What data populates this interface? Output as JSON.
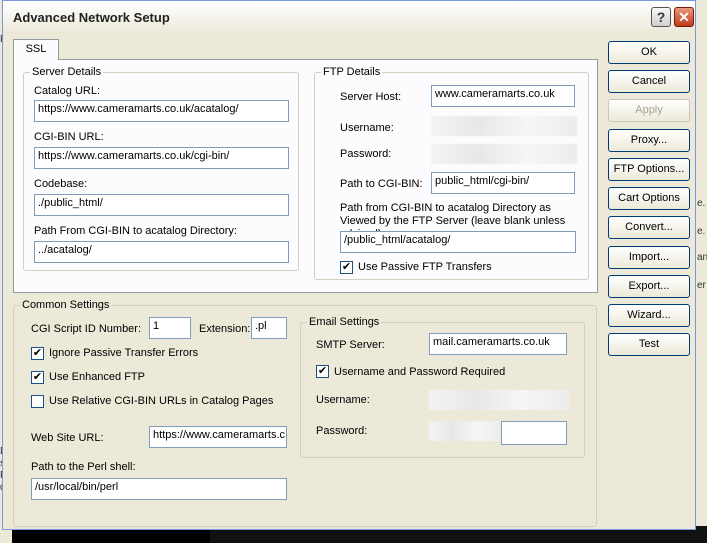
{
  "window": {
    "title": "Advanced Network Setup"
  },
  "tabs": [
    {
      "label": "SSL"
    }
  ],
  "server_details": {
    "legend": "Server Details",
    "catalog_url": {
      "label": "Catalog URL:",
      "value": "https://www.cameramarts.co.uk/acatalog/"
    },
    "cgi_bin_url": {
      "label": "CGI-BIN URL:",
      "value": "https://www.cameramarts.co.uk/cgi-bin/"
    },
    "codebase": {
      "label": "Codebase:",
      "value": "./public_html/"
    },
    "path_cgi_to_catalog": {
      "label": "Path From CGI-BIN to acatalog Directory:",
      "value": "../acatalog/"
    }
  },
  "ftp_details": {
    "legend": "FTP Details",
    "server_host": {
      "label": "Server Host:",
      "value": "www.cameramarts.co.uk"
    },
    "username": {
      "label": "Username:"
    },
    "password": {
      "label": "Password:"
    },
    "path_to_cgi_bin": {
      "label": "Path to CGI-BIN:",
      "value": "public_html/cgi-bin/"
    },
    "path_cgi_to_catalog_ftp": {
      "label": "Path from CGI-BIN to acatalog Directory as Viewed by the FTP Server (leave blank unless advised)",
      "value": "/public_html/acatalog/"
    },
    "use_passive": {
      "label": "Use Passive FTP Transfers",
      "checked": true
    }
  },
  "common_settings": {
    "legend": "Common Settings",
    "cgi_script_id": {
      "label": "CGI Script ID Number:",
      "value": "1"
    },
    "extension": {
      "label": "Extension:",
      "value": ".pl"
    },
    "ignore_passive": {
      "label": "Ignore Passive Transfer Errors",
      "checked": true
    },
    "use_enhanced_ftp": {
      "label": "Use Enhanced FTP",
      "checked": true
    },
    "use_relative_cgi": {
      "label": "Use Relative CGI-BIN URLs in Catalog Pages",
      "checked": false
    },
    "web_site_url": {
      "label": "Web Site URL:",
      "value": "https://www.cameramarts.c"
    },
    "perl_shell": {
      "label": "Path to the Perl shell:",
      "value": "/usr/local/bin/perl"
    }
  },
  "email_settings": {
    "legend": "Email Settings",
    "smtp_server": {
      "label": "SMTP Server:",
      "value": "mail.cameramarts.co.uk"
    },
    "auth_required": {
      "label": "Username and Password Required",
      "checked": true
    },
    "username": {
      "label": "Username:"
    },
    "password": {
      "label": "Password:"
    }
  },
  "buttons": {
    "ok": "OK",
    "cancel": "Cancel",
    "apply": "Apply",
    "proxy": "Proxy...",
    "ftp_options": "FTP Options...",
    "cart_options": "Cart Options",
    "convert": "Convert...",
    "import": "Import...",
    "export": "Export...",
    "wizard": "Wizard...",
    "test": "Test"
  },
  "icons": {
    "help": "question-mark-icon",
    "close": "close-x-icon",
    "check": "checkmark-icon"
  },
  "background": {
    "left_fragments": [
      "Pe",
      "De",
      "sc",
      "Fr",
      "de"
    ],
    "right_fragments": [
      "e.",
      "e.",
      "an",
      "er"
    ]
  },
  "colors": {
    "close_button": "#c0391b",
    "window_bg": "#ece9d8",
    "tab_panel_bg": "#fcfcfe",
    "input_border": "#7f9db9"
  }
}
